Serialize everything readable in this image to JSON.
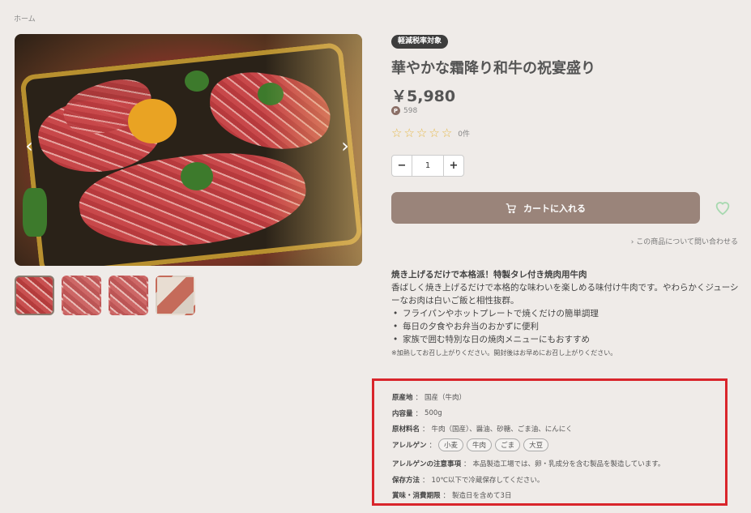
{
  "breadcrumb": "ホーム",
  "product": {
    "badge": "軽減税率対象",
    "title": "華やかな霜降り和牛の祝宴盛り",
    "price": "￥5,980",
    "points_icon": "P",
    "points": "598",
    "rating_count": "0件",
    "stars_filled": 0,
    "stars_total": 5
  },
  "quantity": {
    "minus": "−",
    "value": "1",
    "plus": "+"
  },
  "cart": {
    "label": "カートに入れる",
    "accent": "#9a847a"
  },
  "inquiry": "この商品について問い合わせる",
  "description": {
    "lead": "焼き上げるだけで本格派！特製タレ付き焼肉用牛肉",
    "body": "香ばしく焼き上げるだけで本格的な味わいを楽しめる味付け牛肉です。やわらかくジューシーなお肉は白いご飯と相性抜群。",
    "bullets": [
      "フライパンやホットプレートで焼くだけの簡単調理",
      "毎日の夕食やお弁当のおかずに便利",
      "家族で囲む特別な日の焼肉メニューにもおすすめ"
    ],
    "note": "※加熱してお召し上がりください。開封後はお早めにお召し上がりください。"
  },
  "specs": {
    "origin_label": "原産地",
    "origin": "国産（牛肉）",
    "volume_label": "内容量",
    "volume": "500g",
    "ingredients_label": "原材料名",
    "ingredients": "牛肉（国産）、醤油、砂糖、ごま油、にんにく",
    "allergen_label": "アレルゲン",
    "allergens": [
      "小麦",
      "牛肉",
      "ごま",
      "大豆"
    ],
    "allergen_note_label": "アレルゲンの注意事項",
    "allergen_note": "本品製造工場では、卵・乳成分を含む製品を製造しています。",
    "storage_label": "保存方法",
    "storage": "10℃以下で冷蔵保存してください。",
    "expiry_label": "賞味・消費期限",
    "expiry": "製造日を含めて3日",
    "sep": "："
  },
  "colors": {
    "background": "#efebe8",
    "highlight_border": "#d9252b",
    "star": "#e6b94b",
    "heart": "#a8d9b0"
  }
}
